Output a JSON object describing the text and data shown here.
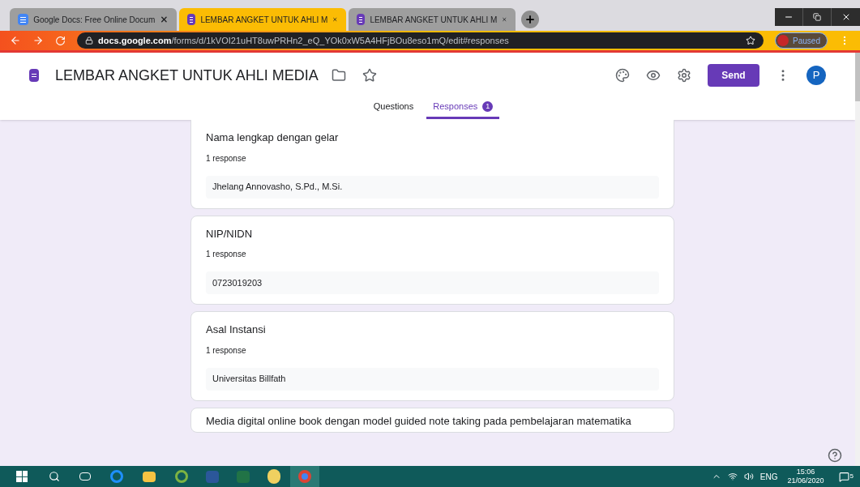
{
  "browser": {
    "tabs": [
      {
        "title": "Google Docs: Free Online Docum",
        "kind": "docs",
        "selected": false
      },
      {
        "title": "LEMBAR ANGKET UNTUK AHLI M",
        "kind": "forms",
        "selected": true
      },
      {
        "title": "LEMBAR ANGKET UNTUK AHLI M",
        "kind": "forms",
        "selected": false
      }
    ],
    "url_host": "docs.google.com",
    "url_path": "/forms/d/1kVOI21uHT8uwPRHn2_eQ_YOk0xW5A4HFjBOu8eso1mQ/edit#responses",
    "profile_status": "Paused"
  },
  "form": {
    "title": "LEMBAR ANGKET UNTUK AHLI MEDIA",
    "send_label": "Send",
    "avatar_letter": "P",
    "tabs": [
      {
        "label": "Questions",
        "selected": false
      },
      {
        "label": "Responses",
        "selected": true,
        "badge": "1"
      }
    ]
  },
  "questions": [
    {
      "title": "Nama lengkap dengan gelar",
      "count": "1 response",
      "answer": "Jhelang Annovasho, S.Pd., M.Si."
    },
    {
      "title": "NIP/NIDN",
      "count": "1 response",
      "answer": "0723019203"
    },
    {
      "title": "Asal Instansi",
      "count": "1 response",
      "answer": "Universitas Billfath"
    },
    {
      "title": "Media digital online book dengan model guided note taking pada pembelajaran matematika"
    }
  ],
  "taskbar": {
    "language": "ENG",
    "time": "15:06",
    "date": "21/06/2020",
    "notifications": "5"
  }
}
